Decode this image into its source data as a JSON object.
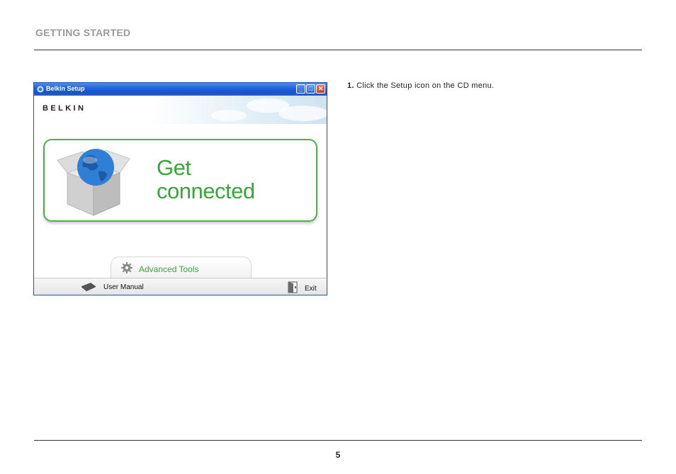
{
  "header": {
    "section_title": "GETTING STARTED"
  },
  "step": {
    "number": "1.",
    "text": "Click the Setup icon on the CD menu."
  },
  "window": {
    "title": "Belkin Setup",
    "controls": {
      "minimize": "_",
      "maximize": "□",
      "close": "✕"
    },
    "brand": "BELKIN",
    "main_button": {
      "line1": "Get",
      "line2": "connected"
    },
    "advanced_tools": {
      "label": "Advanced Tools",
      "icon": "gear-icon"
    },
    "footer": {
      "user_manual": "User Manual",
      "exit": "Exit"
    }
  },
  "colors": {
    "accent_green": "#3aa53a",
    "titlebar_blue": "#1f5fd8"
  },
  "footer": {
    "page_number": "5"
  }
}
